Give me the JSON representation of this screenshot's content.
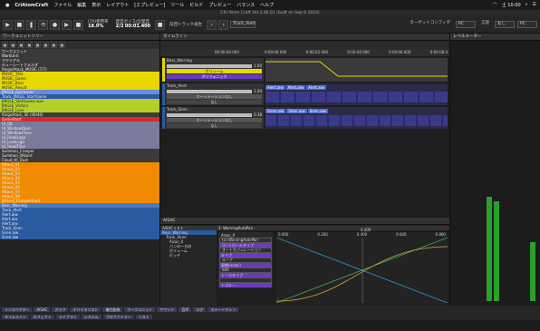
{
  "menubar": {
    "app": "CriAtomCraft",
    "items": [
      "ファイル",
      "編集",
      "表示",
      "レイアウト",
      "[エプレビュー]",
      "ツール",
      "ビルド",
      "プレビュー",
      "バランス",
      "ヘルプ"
    ],
    "clock": "土 10:00"
  },
  "window_title": "CRI Atom Craft Ver.3.46.01 (built on Sep  8 2016)",
  "toolbar": {
    "cpu_label": "CPU使用率",
    "cpu": "18.0%",
    "voice_label": "発音ボイス/全発音",
    "voices": "2/2",
    "time": "00:01.400",
    "loop_label": "前回トラック再生",
    "track": "Track_Alert",
    "target_label": "ターゲットコンフィグ",
    "target": "PC",
    "device_label": "言語",
    "device": "なし",
    "target2": "PC"
  },
  "panels": {
    "workunit": "ワークユニットツリー",
    "timeline": "タイムライン",
    "level": "レベルメーター",
    "aisac": "AISAC"
  },
  "tree": [
    {
      "t": "ワークユニット",
      "c": "#3a3a3a"
    },
    {
      "t": "WorkUnit",
      "c": "#3a3a3a"
    },
    {
      "t": "マテリアル",
      "c": "#3a3a3a"
    },
    {
      "t": "キューシートフォルダ",
      "c": "#3a3a3a"
    },
    {
      "t": "Ringo/Atack_MUSIC (7/7)",
      "c": "#3a3a3a"
    },
    {
      "t": "MUSIC_Title",
      "c": "#e6d800"
    },
    {
      "t": "MUSIC_Game",
      "c": "#e6d800"
    },
    {
      "t": "MUSIC_Boss",
      "c": "#e6d800"
    },
    {
      "t": "MUSIC_Result",
      "c": "#e6d800"
    },
    {
      "t": "JINGLE_Gameover",
      "c": "#6a8ce0"
    },
    {
      "t": "Track_JINGLE_StartGame",
      "c": "#2a5aa0"
    },
    {
      "t": "JINGLE_StartGame.wav",
      "c": "#b5cf2a"
    },
    {
      "t": "JINGLE_Victory",
      "c": "#b5cf2a"
    },
    {
      "t": "JINGLE_Lose",
      "c": "#b5cf2a"
    },
    {
      "t": "RingoAtack_SE (40/40)",
      "c": "#3a3a3a"
    },
    {
      "t": "GameStart",
      "c": "#d42a2a"
    },
    {
      "t": "UI_OK",
      "c": "#7a7a9a"
    },
    {
      "t": "UI_WindowOpen",
      "c": "#7a7a9a"
    },
    {
      "t": "UI_WindowClose",
      "c": "#7a7a9a"
    },
    {
      "t": "UI_HeadLogo",
      "c": "#7a7a9a"
    },
    {
      "t": "UI_LoseLogo",
      "c": "#7a7a9a"
    },
    {
      "t": "UI_HeadTime",
      "c": "#7a7a9a"
    },
    {
      "t": "Summon_Creeper",
      "c": "#3a3a3a"
    },
    {
      "t": "Summon_Wizard",
      "c": "#3a3a3a"
    },
    {
      "t": "Cloud_HI_Dust",
      "c": "#3a3a3a"
    },
    {
      "t": "Attack_01",
      "c": "#f08a00"
    },
    {
      "t": "Attack_02",
      "c": "#f08a00"
    },
    {
      "t": "Attack_03",
      "c": "#f08a00"
    },
    {
      "t": "Attack_04",
      "c": "#f08a00"
    },
    {
      "t": "Attack_05",
      "c": "#f08a00"
    },
    {
      "t": "Attack_06",
      "c": "#f08a00"
    },
    {
      "t": "Attack_07",
      "c": "#f08a00"
    },
    {
      "t": "Attack_08",
      "c": "#f08a00"
    },
    {
      "t": "Wizard_ChargeAttack",
      "c": "#f08a00"
    },
    {
      "t": "Boss_Warning",
      "c": "#4a7ac0"
    },
    {
      "t": "Track_Alert",
      "c": "#2a5aa0"
    },
    {
      "t": "Alert.aiw",
      "c": "#2a5aa0"
    },
    {
      "t": "Alert.aiw",
      "c": "#2a5aa0"
    },
    {
      "t": "Alert.aiw",
      "c": "#2a5aa0"
    },
    {
      "t": "Track_Siren",
      "c": "#2a5aa0"
    },
    {
      "t": "Siren.aiw",
      "c": "#2a5aa0"
    },
    {
      "t": "Siren.aiw",
      "c": "#2a5aa0"
    }
  ],
  "timeline": {
    "time": "00:00:00.000",
    "rulers": [
      "0:00:00.000",
      "0:00:02.000",
      "0:00:04.000",
      "0:00:06.000",
      "0:00:08.0"
    ],
    "tracks": [
      {
        "name": "Boss_Warning",
        "param": "ボリューム",
        "sub": "ポリフォニック",
        "val": "1.00"
      },
      {
        "name": "Track_Alert",
        "param": "オートメーションなし",
        "sub": "なし",
        "val": "1.00"
      },
      {
        "name": "Track_Siren",
        "param": "オートメーションなし",
        "sub": "なし",
        "val": "0.38"
      }
    ],
    "clip_alert": "Alert.aiw",
    "clip_siren": "Siren.aiw"
  },
  "aisac": {
    "list_head": "AISACリスト",
    "item_head": "2: WarningAutoPan",
    "tree": [
      "Boss_Warning",
      "Track_Siren",
      "Aisac_0",
      "パンの一方向",
      "ボリューム",
      "ピッチ"
    ],
    "props": {
      "name_label": "Aisac_0",
      "sel": "[o] WarningAutoPan",
      "ctrl_type_label": "コントロールタイプ",
      "ctrl_type": "オートモジュレーション",
      "type_label": "タイプ",
      "type": "ループ",
      "period_label": "周期(msec)",
      "period": "600",
      "key_label": "トーカタイプ",
      "key": "",
      "key2_label": "トゴキー"
    },
    "axis": [
      "0.000",
      "0.200",
      "0.400",
      "0.600",
      "0.800"
    ],
    "marker": "0.400"
  },
  "statusbar": {
    "row1": [
      "インスペクター",
      "AISAC",
      "グラフ",
      "デバイスリスト",
      "補完曲線",
      "ワークユニット",
      "サウンド",
      "音声",
      "ログ",
      "ステートマシン"
    ],
    "row2": [
      "タイムライン",
      "エフェクト",
      "ライブラリ",
      "システム",
      "プロファイラー",
      "リスト"
    ]
  },
  "colors": {
    "accent": "#3aa0ff",
    "level_green": "#2aa02a"
  }
}
